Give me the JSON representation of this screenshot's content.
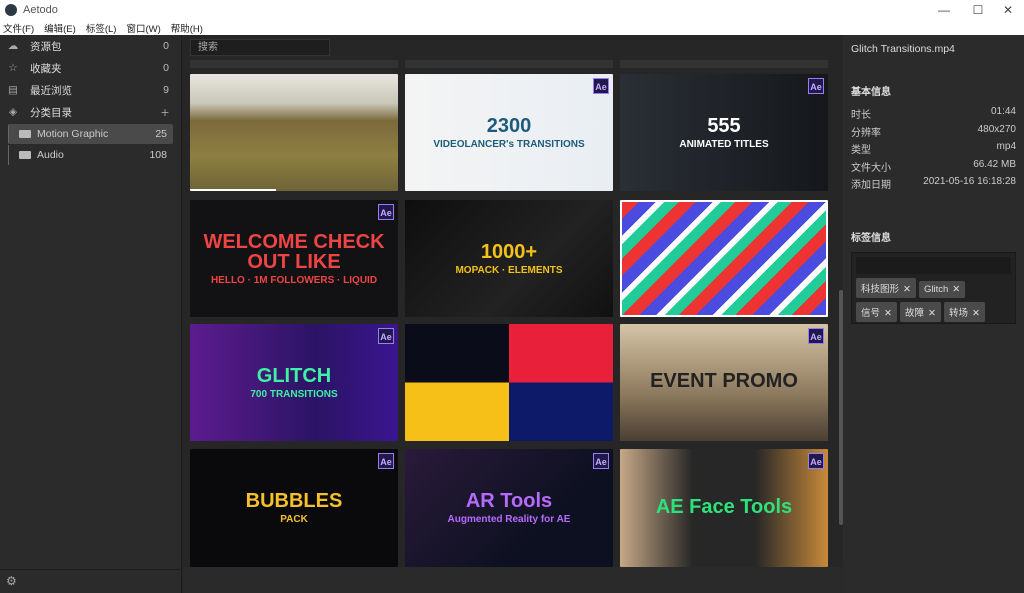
{
  "app": {
    "title": "Aetodo",
    "minimize": "—",
    "maximize": "☐",
    "close": "✕"
  },
  "menu": [
    "文件(F)",
    "编辑(E)",
    "标签(L)",
    "窗口(W)",
    "帮助(H)"
  ],
  "sidebar": {
    "items": [
      {
        "label": "资源包",
        "count": "0",
        "icon": "☁"
      },
      {
        "label": "收藏夹",
        "count": "0",
        "icon": "☆"
      },
      {
        "label": "最近浏览",
        "count": "9",
        "icon": "▤"
      },
      {
        "label": "分类目录",
        "count": "+",
        "icon": "◈"
      }
    ],
    "folders": [
      {
        "label": "Motion Graphic",
        "count": "25",
        "selected": true
      },
      {
        "label": "Audio",
        "count": "108"
      }
    ],
    "settings_icon": "⚙"
  },
  "search": {
    "placeholder": "搜索"
  },
  "thumbnails": [
    {
      "t1": "",
      "t2": "",
      "bg": "linear-gradient(180deg,#e8e6df 0%,#c9c7b8 25%,#7c6a3c 40%,#8e7f42 70%,#6e6436 100%)",
      "badge": ""
    },
    {
      "t1": "2300",
      "t2": "VIDEOLANCER's TRANSITIONS",
      "bg": "linear-gradient(90deg,#f4f4f4 0%,#e9eef3 100%)",
      "color": "#1d5b7a",
      "badge": "Ae"
    },
    {
      "t1": "555",
      "t2": "ANIMATED TITLES",
      "bg": "linear-gradient(90deg,#2a2f36,#15171b)",
      "color": "#fff",
      "badge": "Ae"
    },
    {
      "t1": "WELCOME  CHECK OUT  LIKE",
      "t2": "HELLO · 1M FOLLOWERS · LIQUID",
      "bg": "#121214",
      "color": "#e44",
      "badge": "Ae"
    },
    {
      "t1": "1000+",
      "t2": "MOPACK · ELEMENTS",
      "bg": "linear-gradient(135deg,#0e0e0e,#222 60%,#111)",
      "color": "#f4c21a",
      "badge": ""
    },
    {
      "t1": "",
      "t2": "",
      "bg": "repeating-linear-gradient(135deg,#e33 0 12px,#4b4be0 12px 24px,#fff 24px 30px,#2c9 30px 40px)",
      "badge": ""
    },
    {
      "t1": "GLITCH",
      "t2": "700 TRANSITIONS",
      "bg": "linear-gradient(90deg,#5d1c8e,#2b1465 60%,#3a1590)",
      "color": "#3df2a5",
      "badge": "Ae"
    },
    {
      "t1": "",
      "t2": "",
      "bg": "linear-gradient(#0a0c1a 0 50%,#f7c018 50%) left/50% 100% no-repeat,linear-gradient(#e8203a 0 50%,#0d1a6a 50%) right/50% 100% no-repeat",
      "badge": ""
    },
    {
      "t1": "EVENT PROMO",
      "t2": "",
      "bg": "linear-gradient(180deg,#d6c4a6,#8d7a5e 60%,#4a3f32)",
      "color": "#222",
      "badge": "Ae"
    },
    {
      "t1": "BUBBLES",
      "t2": "PACK",
      "bg": "#0a0a0d",
      "color": "#f5c02b",
      "badge": "Ae"
    },
    {
      "t1": "AR Tools",
      "t2": "Augmented Reality for AE",
      "bg": "linear-gradient(135deg,#2a1a3a,#0c1020 70%)",
      "color": "#b66bff",
      "badge": "Ae"
    },
    {
      "t1": "AE Face Tools",
      "t2": "",
      "bg": "linear-gradient(90deg,#c7a887 0%,#272727 35%,#272727 65%,#c88a3a 100%)",
      "color": "#2ee27a",
      "badge": "Ae"
    }
  ],
  "detail": {
    "filename": "Glitch Transitions.mp4",
    "basic_title": "基本信息",
    "rows": [
      {
        "k": "时长",
        "v": "01:44"
      },
      {
        "k": "分辨率",
        "v": "480x270"
      },
      {
        "k": "类型",
        "v": "mp4"
      },
      {
        "k": "文件大小",
        "v": "66.42 MB"
      },
      {
        "k": "添加日期",
        "v": "2021-05-16 16:18:28"
      }
    ],
    "tags_title": "标签信息",
    "tags": [
      "科技图形",
      "Glitch",
      "信号",
      "故障",
      "转场"
    ],
    "tag_remove": "✕"
  }
}
